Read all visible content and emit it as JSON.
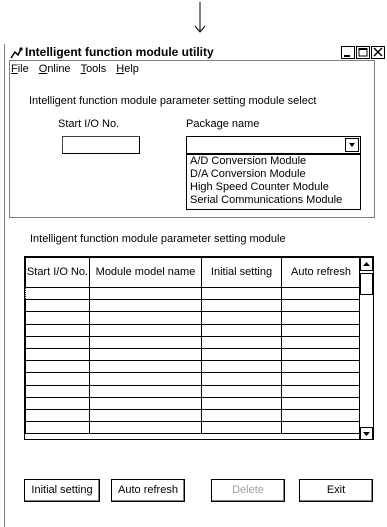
{
  "window": {
    "title": "Intelligent function module utility"
  },
  "menu": [
    {
      "label": "File",
      "accel": "F",
      "rest": "ile"
    },
    {
      "label": "Online",
      "accel": "O",
      "rest": "nline"
    },
    {
      "label": "Tools",
      "accel": "T",
      "rest": "ools"
    },
    {
      "label": "Help",
      "accel": "H",
      "rest": "elp"
    }
  ],
  "select_group": {
    "title": "Intelligent function module parameter setting module select",
    "start_io_label": "Start I/O No.",
    "start_io_value": "",
    "package_label": "Package name",
    "package_value": "",
    "package_options": [
      "A/D Conversion Module",
      "D/A Conversion Module",
      "High Speed Counter Module",
      "Serial Communications Module"
    ]
  },
  "setting_group": {
    "title": "Intelligent function module parameter setting module",
    "columns": [
      "Start I/O No.",
      "Module model name",
      "Initial setting",
      "Auto refresh"
    ],
    "rows": [
      [
        "",
        "",
        "",
        ""
      ],
      [
        "",
        "",
        "",
        ""
      ],
      [
        "",
        "",
        "",
        ""
      ],
      [
        "",
        "",
        "",
        ""
      ],
      [
        "",
        "",
        "",
        ""
      ],
      [
        "",
        "",
        "",
        ""
      ],
      [
        "",
        "",
        "",
        ""
      ],
      [
        "",
        "",
        "",
        ""
      ],
      [
        "",
        "",
        "",
        ""
      ],
      [
        "",
        "",
        "",
        ""
      ],
      [
        "",
        "",
        "",
        ""
      ],
      [
        "",
        "",
        "",
        ""
      ]
    ]
  },
  "buttons": {
    "initial_setting": "Initial setting",
    "auto_refresh": "Auto refresh",
    "delete": "Delete",
    "exit": "Exit"
  }
}
